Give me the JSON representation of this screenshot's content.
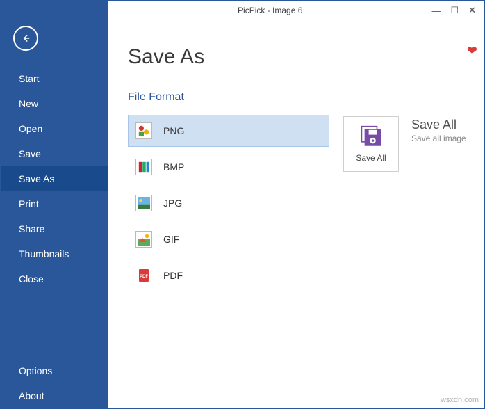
{
  "window": {
    "title": "PicPick - Image 6"
  },
  "sidebar": {
    "items": [
      {
        "label": "Start",
        "selected": false
      },
      {
        "label": "New",
        "selected": false
      },
      {
        "label": "Open",
        "selected": false
      },
      {
        "label": "Save",
        "selected": false
      },
      {
        "label": "Save As",
        "selected": true
      },
      {
        "label": "Print",
        "selected": false
      },
      {
        "label": "Share",
        "selected": false
      },
      {
        "label": "Thumbnails",
        "selected": false
      },
      {
        "label": "Close",
        "selected": false
      }
    ],
    "footer": [
      {
        "label": "Options"
      },
      {
        "label": "About"
      }
    ]
  },
  "page": {
    "title": "Save As",
    "section_title": "File Format"
  },
  "formats": [
    {
      "label": "PNG",
      "icon": "png-icon",
      "selected": true
    },
    {
      "label": "BMP",
      "icon": "bmp-icon",
      "selected": false
    },
    {
      "label": "JPG",
      "icon": "jpg-icon",
      "selected": false
    },
    {
      "label": "GIF",
      "icon": "gif-icon",
      "selected": false
    },
    {
      "label": "PDF",
      "icon": "pdf-icon",
      "selected": false
    }
  ],
  "save_all": {
    "button_label": "Save All",
    "title": "Save All",
    "subtitle": "Save all image"
  },
  "watermark": "wsxdn.com"
}
